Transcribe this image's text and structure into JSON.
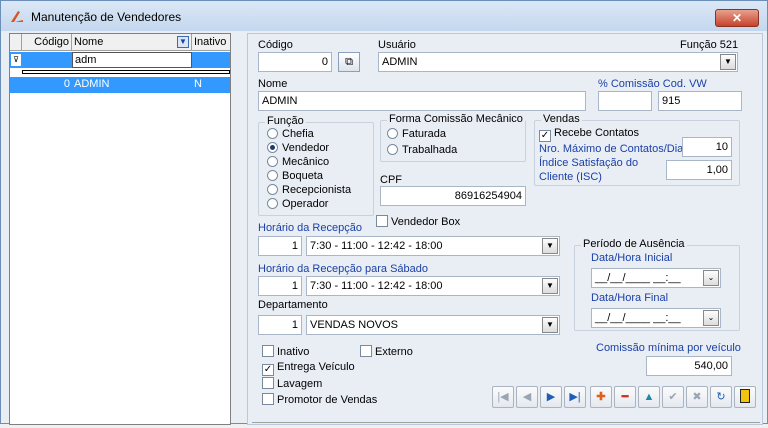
{
  "window": {
    "title": "Manutenção de Vendedores",
    "close_label": "✕"
  },
  "grid": {
    "headers": [
      "Código",
      "Nome",
      "Inativo"
    ],
    "filter_value": "adm",
    "rows": [
      {
        "codigo": "0",
        "nome": "ADMIN",
        "inativo": "N"
      }
    ]
  },
  "form": {
    "codigo_label": "Código",
    "codigo_value": "0",
    "usuario_label": "Usuário",
    "usuario_value": "ADMIN",
    "funcao_code": "Função 521",
    "nome_label": "Nome",
    "nome_value": "ADMIN",
    "comissao_vw_label": "% Comissão Cod. VW",
    "comissao_vw_value": "",
    "comissao_vw_code": "915",
    "funcao_group": {
      "title": "Função",
      "options": [
        "Chefia",
        "Vendedor",
        "Mecânico",
        "Boqueta",
        "Recepcionista",
        "Operador"
      ],
      "selected": "Vendedor"
    },
    "forma_comissao": {
      "title": "Forma Comissão Mecânico",
      "options": [
        "Faturada",
        "Trabalhada"
      ]
    },
    "vendas": {
      "title": "Vendas",
      "recebe_contatos": "Recebe Contatos",
      "max_contatos_label": "Nro. Máximo de Contatos/Dia",
      "max_contatos_value": "10",
      "isc_label_1": "Índice Satisfação do",
      "isc_label_2": "Cliente (ISC)",
      "isc_value": "1,00"
    },
    "cpf_label": "CPF",
    "cpf_value": "86916254904",
    "vendedor_box": "Vendedor Box",
    "horario_recepcao_label": "Horário da Recepção",
    "horario_recepcao_num": "1",
    "horario_recepcao_value": "7:30 - 11:00 - 12:42 - 18:00",
    "horario_sabado_label": "Horário da Recepção para Sábado",
    "horario_sabado_num": "1",
    "horario_sabado_value": "7:30 - 11:00 - 12:42 - 18:00",
    "departamento_label": "Departamento",
    "departamento_num": "1",
    "departamento_value": "VENDAS NOVOS",
    "ausencia": {
      "title": "Período de Ausência",
      "inicial_label": "Data/Hora Inicial",
      "inicial_value": "__/__/____ __:__",
      "final_label": "Data/Hora Final",
      "final_value": "__/__/____ __:__"
    },
    "checks": {
      "inativo": "Inativo",
      "externo": "Externo",
      "entrega_veiculo": "Entrega Veículo",
      "lavagem": "Lavagem",
      "promotor": "Promotor de Vendas"
    },
    "comissao_minima_label": "Comissão mínima por veículo",
    "comissao_minima_value": "540,00"
  },
  "colors": {
    "selection": "#3399ff",
    "label_blue": "#1a3fa6",
    "window_bg": "#e9eef5"
  }
}
